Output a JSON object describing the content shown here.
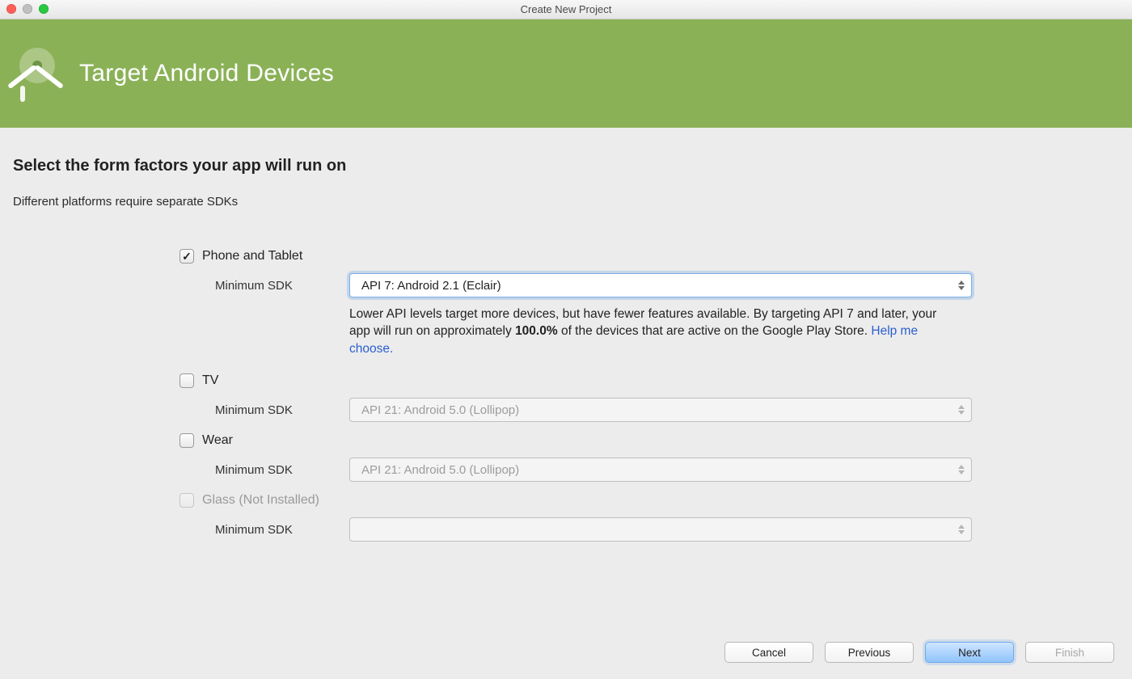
{
  "window": {
    "title": "Create New Project"
  },
  "header": {
    "title": "Target Android Devices"
  },
  "page": {
    "heading": "Select the form factors your app will run on",
    "subheading": "Different platforms require separate SDKs"
  },
  "form": {
    "min_sdk_label": "Minimum SDK",
    "phone": {
      "label": "Phone and Tablet",
      "checked": true,
      "sdk_value": "API 7: Android 2.1 (Eclair)",
      "help_prefix": "Lower API levels target more devices, but have fewer features available. By targeting API 7 and later, your app will run on approximately ",
      "help_bold": "100.0%",
      "help_suffix": " of the devices that are active on the Google Play Store. ",
      "help_link": "Help me choose."
    },
    "tv": {
      "label": "TV",
      "checked": false,
      "sdk_value": "API 21: Android 5.0 (Lollipop)"
    },
    "wear": {
      "label": "Wear",
      "checked": false,
      "sdk_value": "API 21: Android 5.0 (Lollipop)"
    },
    "glass": {
      "label": "Glass (Not Installed)",
      "checked": false,
      "sdk_value": ""
    }
  },
  "footer": {
    "cancel": "Cancel",
    "previous": "Previous",
    "next": "Next",
    "finish": "Finish"
  }
}
